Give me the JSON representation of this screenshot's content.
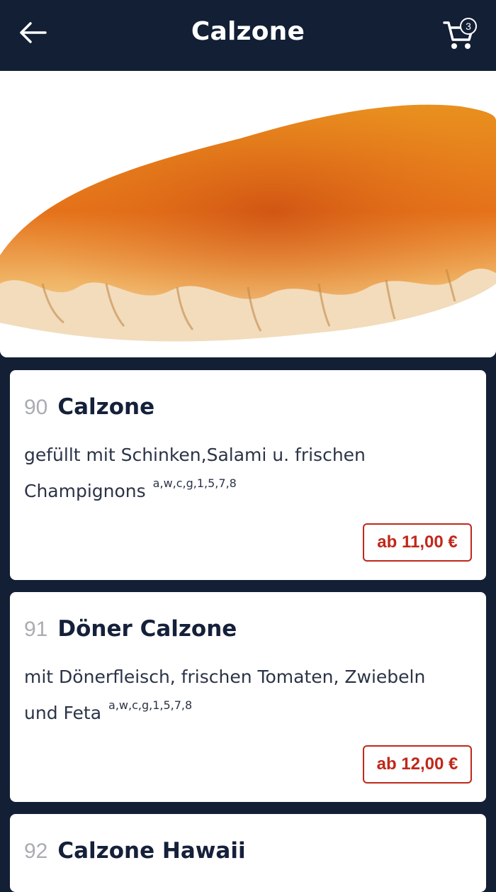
{
  "header": {
    "title": "Calzone",
    "cart_count": "3",
    "back_icon": "arrow-left-icon",
    "cart_icon": "shopping-cart-icon"
  },
  "hero": {
    "image": "calzone-photo"
  },
  "items": [
    {
      "number": "90",
      "name": "Calzone",
      "description": "gefüllt mit Schinken,Salami u. frischen Champignons",
      "allergens": "a,w,c,g,1,5,7,8",
      "price": "ab 11,00 €"
    },
    {
      "number": "91",
      "name": "Döner Calzone",
      "description": "mit Dönerfleisch, frischen Tomaten, Zwiebeln und Feta",
      "allergens": "a,w,c,g,1,5,7,8",
      "price": "ab 12,00 €"
    },
    {
      "number": "92",
      "name": "Calzone Hawaii"
    }
  ],
  "colors": {
    "header_bg": "#131f35",
    "price_accent": "#c0281a",
    "item_number": "#a9acb3",
    "title_text": "#15203a"
  }
}
